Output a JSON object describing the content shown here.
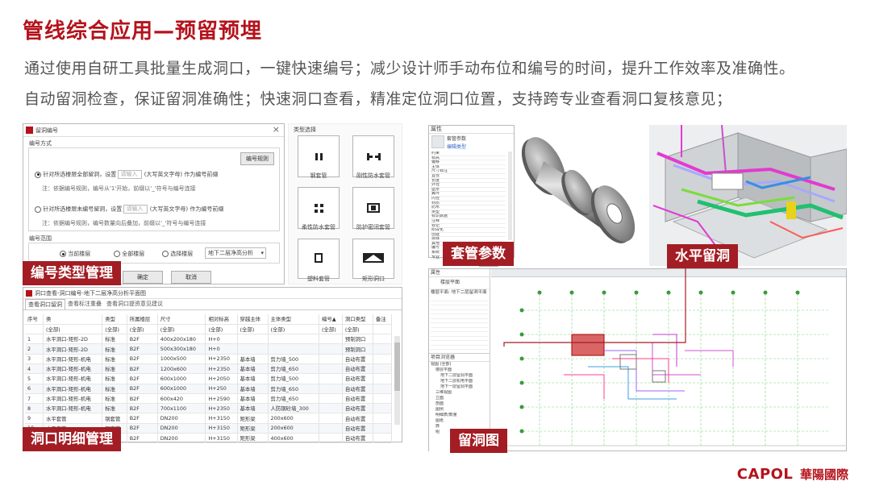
{
  "slide": {
    "title": "管线综合应用—预留预埋",
    "line1": "通过使用自研工具批量生成洞口，一键快速编号；减少设计师手动布位和编号的时间，提升工作效率及准确性。",
    "line2": "自动留洞检查，保证留洞准确性；快速洞口查看，精准定位洞口位置，支持跨专业查看洞口复核意见；"
  },
  "captions": {
    "numbering": "编号类型管理",
    "sleeve": "套管参数",
    "horizontal": "水平留洞",
    "detail": "洞口明细管理",
    "drawing": "留洞图"
  },
  "logo": {
    "en": "CAPOL",
    "cn": "華陽國際"
  },
  "numbering_dialog": {
    "title": "留洞编号",
    "close": "×",
    "mode_label": "编号方式",
    "rule_button": "编号规则",
    "opt1_prefix": "针对所选楼层全部留洞，设置",
    "opt1_placeholder": "请输入",
    "opt1_suffix": "(大写英文字母) 作为编号前缀",
    "note1": "注：依据编号规则，编号从'1'开始，前缀以'_'符号与编号连接",
    "opt2_prefix": "针对所选楼层未编号留洞，设置",
    "opt2_placeholder": "请输入",
    "opt2_suffix": "(大写英文字母) 作为编号前缀",
    "note2": "注：依据编号规则，编号数量向后叠加，前缀以'_'符号与编号连接",
    "range_label": "编号范围",
    "range_current": "当前楼层",
    "range_all": "全部楼层",
    "range_select": "选择楼层",
    "floor_select": "地下二层净高分析",
    "ok": "确定",
    "cancel": "取消"
  },
  "type_panel": {
    "title": "类型选择",
    "tiles": [
      "钢套管",
      "刚性防水套管",
      "柔性防水套管",
      "防护密闭套管",
      "塑料套管",
      "矩形洞口"
    ]
  },
  "sleeve_props": {
    "header": "属性",
    "type_field": "套管参数",
    "edit_type": "编辑类型",
    "rows": [
      "约束",
      "标高",
      "偏移",
      "主体",
      "尺寸标注",
      "直径",
      "长度",
      "外径",
      "壁厚",
      "翼环",
      "内径",
      "材质",
      "防水",
      "类型",
      "标识数据",
      "注释",
      "标记",
      "阶段化",
      "创建",
      "拆除",
      "其他",
      "编号",
      "系统",
      "专业"
    ],
    "apply": "应用"
  },
  "detail_table": {
    "title": "洞口查看-洞口编号-地下二层净高分析平面图",
    "tabs": [
      "查看洞口留洞",
      "查看标注重叠",
      "查看洞口提资意见建议"
    ],
    "columns": [
      "序号",
      "类",
      "类型",
      "所属楼层",
      "尺寸",
      "相对标高",
      "穿越主体",
      "主体类型",
      "编号▲",
      "洞口类型",
      "备注"
    ],
    "filter": "(全部)",
    "rows": [
      [
        "1",
        "水平洞口-矩形-2D",
        "标准",
        "B2F",
        "400x200x180",
        "H+0",
        "",
        "",
        "",
        "预制洞口",
        ""
      ],
      [
        "2",
        "水平洞口-矩形-2D",
        "标准",
        "B2F",
        "500x300x180",
        "H+0",
        "",
        "",
        "",
        "预制洞口",
        ""
      ],
      [
        "3",
        "水平洞口-矩形-机电",
        "标准",
        "B2F",
        "1000x500",
        "H+2350",
        "基本墙",
        "剪力墙_500",
        "",
        "自动布置",
        ""
      ],
      [
        "4",
        "水平洞口-矩形-机电",
        "标准",
        "B2F",
        "1200x600",
        "H+2350",
        "基本墙",
        "剪力墙_650",
        "",
        "自动布置",
        ""
      ],
      [
        "5",
        "水平洞口-矩形-机电",
        "标准",
        "B2F",
        "600x1000",
        "H+2050",
        "基本墙",
        "剪力墙_500",
        "",
        "自动布置",
        ""
      ],
      [
        "6",
        "水平洞口-矩形-机电",
        "标准",
        "B2F",
        "600x1000",
        "H+250",
        "基本墙",
        "剪力墙_650",
        "",
        "自动布置",
        ""
      ],
      [
        "7",
        "水平洞口-矩形-机电",
        "标准",
        "B2F",
        "600x420",
        "H+2590",
        "基本墙",
        "剪力墙_650",
        "",
        "自动布置",
        ""
      ],
      [
        "8",
        "水平洞口-矩形-机电",
        "标准",
        "B2F",
        "700x1100",
        "H+2350",
        "基本墙",
        "人防钢砼墙_300",
        "",
        "自动布置",
        ""
      ],
      [
        "9",
        "水平套管",
        "钢套管",
        "B2F",
        "DN200",
        "H+3150",
        "矩形梁",
        "200x600",
        "",
        "自动布置",
        ""
      ],
      [
        "10",
        "水平套管",
        "钢套管",
        "B2F",
        "DN200",
        "H+3150",
        "矩形梁",
        "200x600",
        "",
        "自动布置",
        ""
      ],
      [
        "11",
        "",
        "钢套管",
        "B2F",
        "DN200",
        "H+3150",
        "矩形梁",
        "400x600",
        "",
        "自动布置",
        ""
      ]
    ]
  },
  "drawing_panel": {
    "prop_header": "属性",
    "view_field": "楼层平面",
    "view_name": "楼层平面: 地下二层留洞平面",
    "browser_title": "项目浏览器",
    "tree": [
      "视图 (全部)",
      "楼层平面",
      "地下二层留洞平面",
      "地下二层机电平面",
      "地下一层留洞平面",
      "三维视图",
      "立面",
      "剖面",
      "图例",
      "明细表/数量",
      "图纸",
      "族",
      "组"
    ]
  },
  "colors": {
    "brand": "#b5121b",
    "caption_bg": "#a31d24",
    "text": "#555555"
  }
}
